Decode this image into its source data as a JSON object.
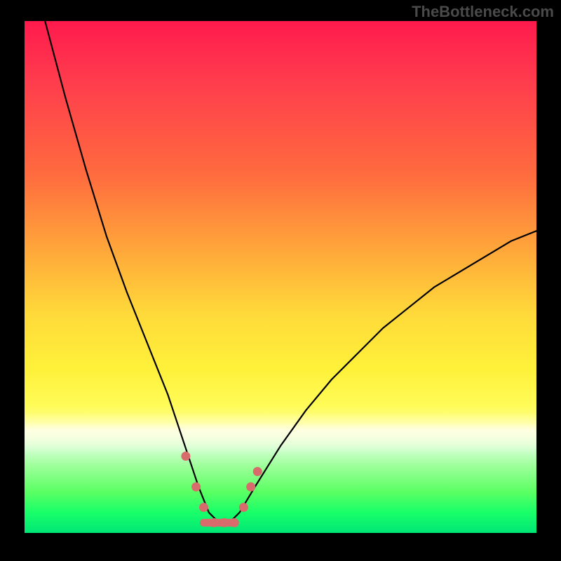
{
  "watermark": "TheBottleneck.com",
  "chart_data": {
    "type": "line",
    "title": "",
    "xlabel": "",
    "ylabel": "",
    "xlim": [
      0,
      100
    ],
    "ylim": [
      0,
      100
    ],
    "legend": "none",
    "grid": false,
    "description": "Bottleneck-style V-shaped curve over a red→green vertical gradient. Y represents bottleneck severity (top=red=high, bottom=green=low); X is an unlabeled parameter (e.g. GPU/CPU balance). The curve reaches its minimum near x≈37 where it dips into the green band. Flat bottom segment and adjacent points are highlighted with pink/coral markers.",
    "series": [
      {
        "name": "bottleneck-curve",
        "x": [
          4,
          8,
          12,
          16,
          20,
          24,
          28,
          31,
          34,
          36,
          38,
          40,
          42,
          45,
          50,
          55,
          60,
          65,
          70,
          75,
          80,
          85,
          90,
          95,
          100
        ],
        "y": [
          100,
          85,
          71,
          58,
          47,
          37,
          27,
          18,
          9,
          4,
          2,
          2,
          4,
          9,
          17,
          24,
          30,
          35,
          40,
          44,
          48,
          51,
          54,
          57,
          59
        ]
      }
    ],
    "highlights": [
      {
        "x": 31.5,
        "y": 15
      },
      {
        "x": 33.5,
        "y": 9
      },
      {
        "x": 35.0,
        "y": 5
      },
      {
        "x": 37.0,
        "y": 2
      },
      {
        "x": 39.0,
        "y": 2
      },
      {
        "x": 41.0,
        "y": 2
      },
      {
        "x": 42.8,
        "y": 5
      },
      {
        "x": 44.2,
        "y": 9
      },
      {
        "x": 45.5,
        "y": 12
      }
    ],
    "highlight_segment": {
      "x0": 35,
      "x1": 41,
      "y": 2
    }
  },
  "colors": {
    "curve": "#000000",
    "highlight": "#d86b6b",
    "gradient_top": "#ff1a4d",
    "gradient_bottom": "#00e676"
  }
}
